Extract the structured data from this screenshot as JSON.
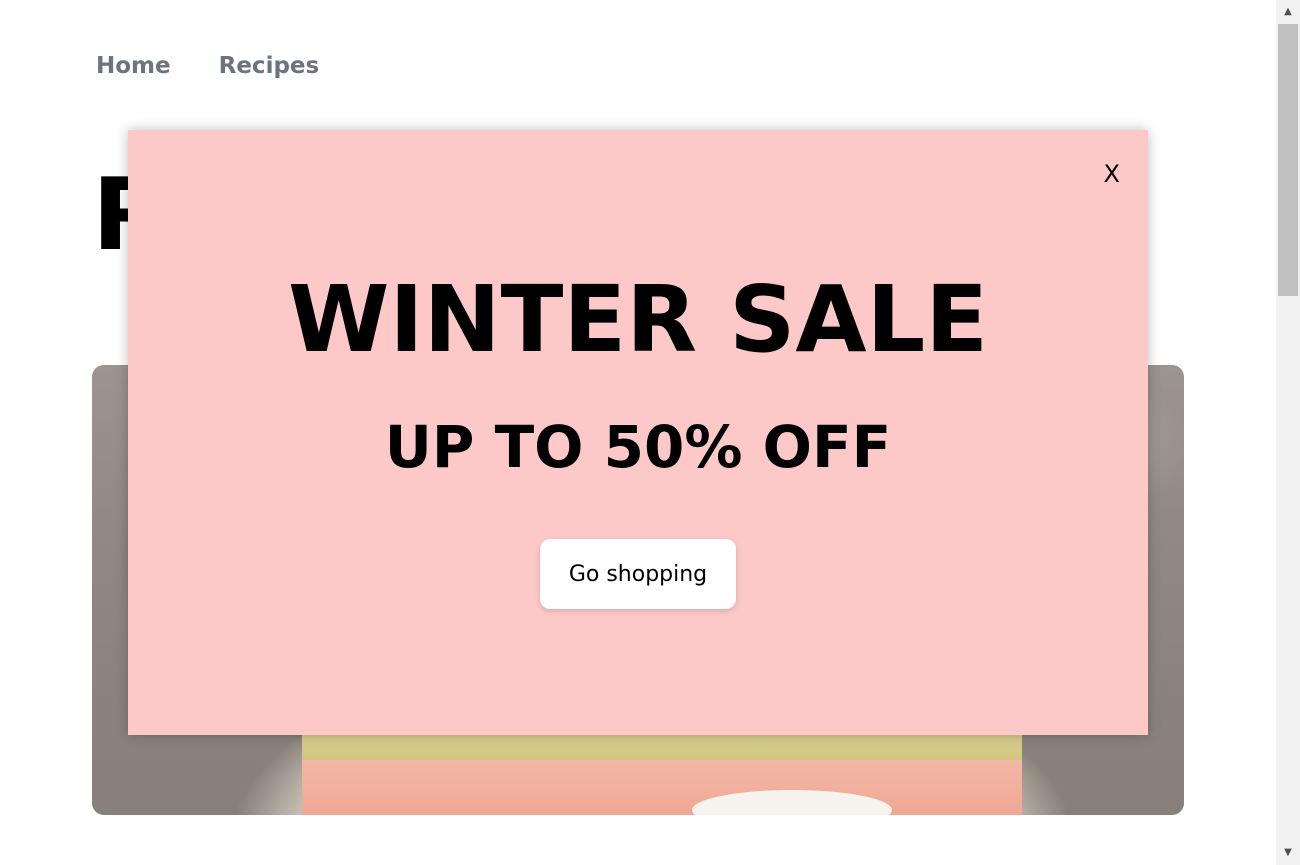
{
  "nav": {
    "items": [
      {
        "label": "Home"
      },
      {
        "label": "Recipes"
      }
    ]
  },
  "hero": {
    "title_partial": "R"
  },
  "modal": {
    "close_label": "X",
    "title": "WINTER SALE",
    "subtitle": "UP TO 50% OFF",
    "button_label": "Go shopping"
  },
  "scrollbar": {
    "up_arrow": "▲",
    "down_arrow": "▼"
  }
}
